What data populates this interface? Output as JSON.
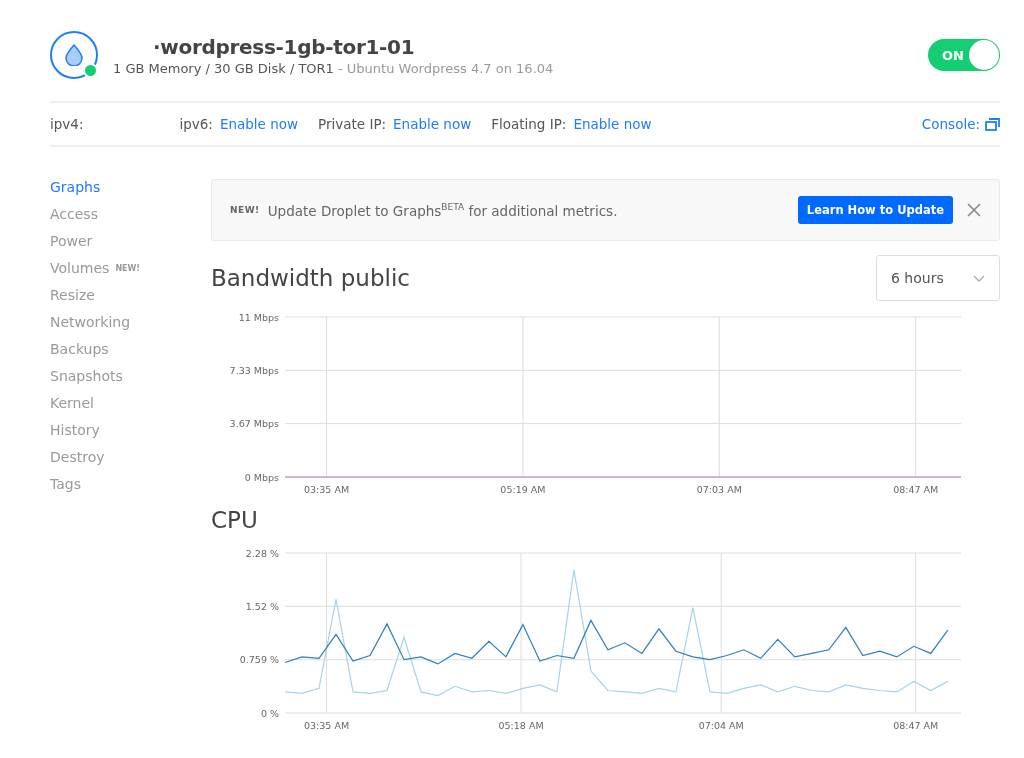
{
  "header": {
    "title": "·wordpress-1gb-tor1-01",
    "specs": "1 GB Memory / 30 GB Disk / TOR1",
    "image": " - Ubuntu Wordpress 4.7 on 16.04",
    "online": true,
    "power": {
      "label": "ON",
      "on": true
    }
  },
  "network": [
    {
      "label": "ipv4:"
    },
    {
      "label": "ipv6:",
      "link": "Enable now"
    },
    {
      "label": "Private IP:",
      "link": "Enable now"
    },
    {
      "label": "Floating IP:",
      "link": "Enable now"
    }
  ],
  "console": "Console:",
  "sidebar": {
    "items": [
      {
        "label": "Graphs",
        "selected": true
      },
      {
        "label": "Access",
        "selected": false
      },
      {
        "label": "Power",
        "selected": false
      },
      {
        "label": "Volumes",
        "badge": "NEW!",
        "selected": false
      },
      {
        "label": "Resize",
        "selected": false
      },
      {
        "label": "Networking",
        "selected": false
      },
      {
        "label": "Backups",
        "selected": false
      },
      {
        "label": "Snapshots",
        "selected": false
      },
      {
        "label": "Kernel",
        "selected": false
      },
      {
        "label": "History",
        "selected": false
      },
      {
        "label": "Destroy",
        "selected": false
      },
      {
        "label": "Tags",
        "selected": false
      }
    ]
  },
  "banner": {
    "tag": "NEW!",
    "message": "Update Droplet to Graphs$^{BETA}$ for additional metrics.",
    "button": "Learn How to Update"
  },
  "range": "6 hours",
  "graphs": [
    {
      "chart_data": {
        "type": "line",
        "title": "Bandwidth public",
        "grid": true,
        "x": [
          193,
          551
        ],
        "xlim": [
          193,
          551
        ],
        "ylim": [
          0,
          11
        ],
        "xticks": [
          {
            "value": 215,
            "label": "03:35 AM"
          },
          {
            "value": 319,
            "label": "05:19 AM"
          },
          {
            "value": 423,
            "label": "07:03 AM"
          },
          {
            "value": 527,
            "label": "08:47 AM"
          }
        ],
        "yticks": [
          {
            "value": 11,
            "label": "11 Mbps"
          },
          {
            "value": 7.33,
            "label": "7.33 Mbps"
          },
          {
            "value": 3.67,
            "label": "3.67 Mbps"
          },
          {
            "value": 0,
            "label": "0 Mbps"
          }
        ],
        "series": [
          {
            "color": "#a77bd1",
            "values": [
              0,
              0
            ]
          }
        ]
      }
    },
    {
      "chart_data": {
        "type": "line",
        "title": "CPU",
        "grid": true,
        "x": [
          193,
          202,
          211,
          220,
          229,
          238,
          247,
          256,
          265,
          274,
          283,
          292,
          301,
          310,
          319,
          328,
          337,
          346,
          355,
          364,
          373,
          382,
          391,
          400,
          409,
          418,
          427,
          436,
          445,
          454,
          463,
          472,
          481,
          490,
          499,
          508,
          517,
          526,
          535,
          544
        ],
        "xlim": [
          193,
          551
        ],
        "ylim": [
          0,
          2.28
        ],
        "xticks": [
          {
            "value": 215,
            "label": "03:35 AM"
          },
          {
            "value": 318,
            "label": "05:18 AM"
          },
          {
            "value": 424,
            "label": "07:04 AM"
          },
          {
            "value": 527,
            "label": "08:47 AM"
          }
        ],
        "yticks": [
          {
            "value": 2.28,
            "label": "2.28 %"
          },
          {
            "value": 1.52,
            "label": "1.52 %"
          },
          {
            "value": 0.759,
            "label": "0.759 %"
          },
          {
            "value": 0,
            "label": "0 %"
          }
        ],
        "series": [
          {
            "color": "#a8d2ea",
            "values": [
              0.3,
              0.28,
              0.35,
              1.62,
              0.3,
              0.28,
              0.32,
              1.08,
              0.3,
              0.25,
              0.38,
              0.3,
              0.32,
              0.28,
              0.35,
              0.4,
              0.3,
              2.04,
              0.6,
              0.32,
              0.3,
              0.28,
              0.35,
              0.3,
              1.5,
              0.3,
              0.28,
              0.35,
              0.4,
              0.3,
              0.38,
              0.32,
              0.3,
              0.4,
              0.35,
              0.32,
              0.3,
              0.45,
              0.32,
              0.45
            ]
          },
          {
            "color": "#2a7fbf",
            "values": [
              0.72,
              0.8,
              0.78,
              1.12,
              0.74,
              0.82,
              1.27,
              0.76,
              0.8,
              0.7,
              0.85,
              0.78,
              1.02,
              0.8,
              1.26,
              0.74,
              0.82,
              0.78,
              1.32,
              0.9,
              1.0,
              0.85,
              1.2,
              0.88,
              0.8,
              0.76,
              0.82,
              0.9,
              0.78,
              1.05,
              0.8,
              0.85,
              0.9,
              1.22,
              0.82,
              0.88,
              0.8,
              0.95,
              0.85,
              1.18
            ]
          }
        ]
      }
    }
  ]
}
